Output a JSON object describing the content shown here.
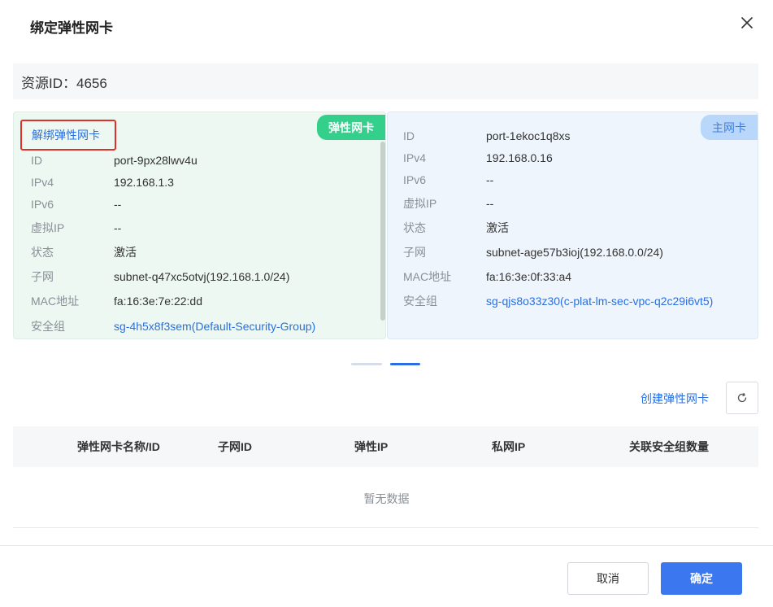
{
  "dialog": {
    "title": "绑定弹性网卡",
    "resource_id_label": "资源ID：4656"
  },
  "elastic_card": {
    "badge": "弹性网卡",
    "unbind_label": "解绑弹性网卡",
    "rows": [
      {
        "key": "ID",
        "value": "port-9px28lwv4u"
      },
      {
        "key": "IPv4",
        "value": "192.168.1.3"
      },
      {
        "key": "IPv6",
        "value": "--"
      },
      {
        "key": "虚拟IP",
        "value": "--"
      },
      {
        "key": "状态",
        "value": "激活"
      },
      {
        "key": "子网",
        "value": "subnet-q47xc5otvj(192.168.1.0/24)"
      },
      {
        "key": "MAC地址",
        "value": "fa:16:3e:7e:22:dd"
      },
      {
        "key": "安全组",
        "value": "sg-4h5x8f3sem(Default-Security-Group)"
      }
    ]
  },
  "primary_card": {
    "badge": "主网卡",
    "rows": [
      {
        "key": "ID",
        "value": "port-1ekoc1q8xs"
      },
      {
        "key": "IPv4",
        "value": "192.168.0.16"
      },
      {
        "key": "IPv6",
        "value": "--"
      },
      {
        "key": "虚拟IP",
        "value": "--"
      },
      {
        "key": "状态",
        "value": "激活"
      },
      {
        "key": "子网",
        "value": "subnet-age57b3ioj(192.168.0.0/24)"
      },
      {
        "key": "MAC地址",
        "value": "fa:16:3e:0f:33:a4"
      },
      {
        "key": "安全组",
        "value": "sg-qjs8o33z30(c-plat-lm-sec-vpc-q2c29i6vt5)"
      }
    ]
  },
  "toolbar": {
    "create_label": "创建弹性网卡"
  },
  "table": {
    "columns": [
      "弹性网卡名称/ID",
      "子网ID",
      "弹性IP",
      "私网IP",
      "关联安全组数量"
    ],
    "empty_text": "暂无数据"
  },
  "footer": {
    "cancel_label": "取消",
    "ok_label": "确定"
  },
  "colors": {
    "accent": "#2a6fe2",
    "elastic_badge": "#35cf8c",
    "primary_badge": "#b9d7fb",
    "highlight_border": "#e0302a"
  }
}
